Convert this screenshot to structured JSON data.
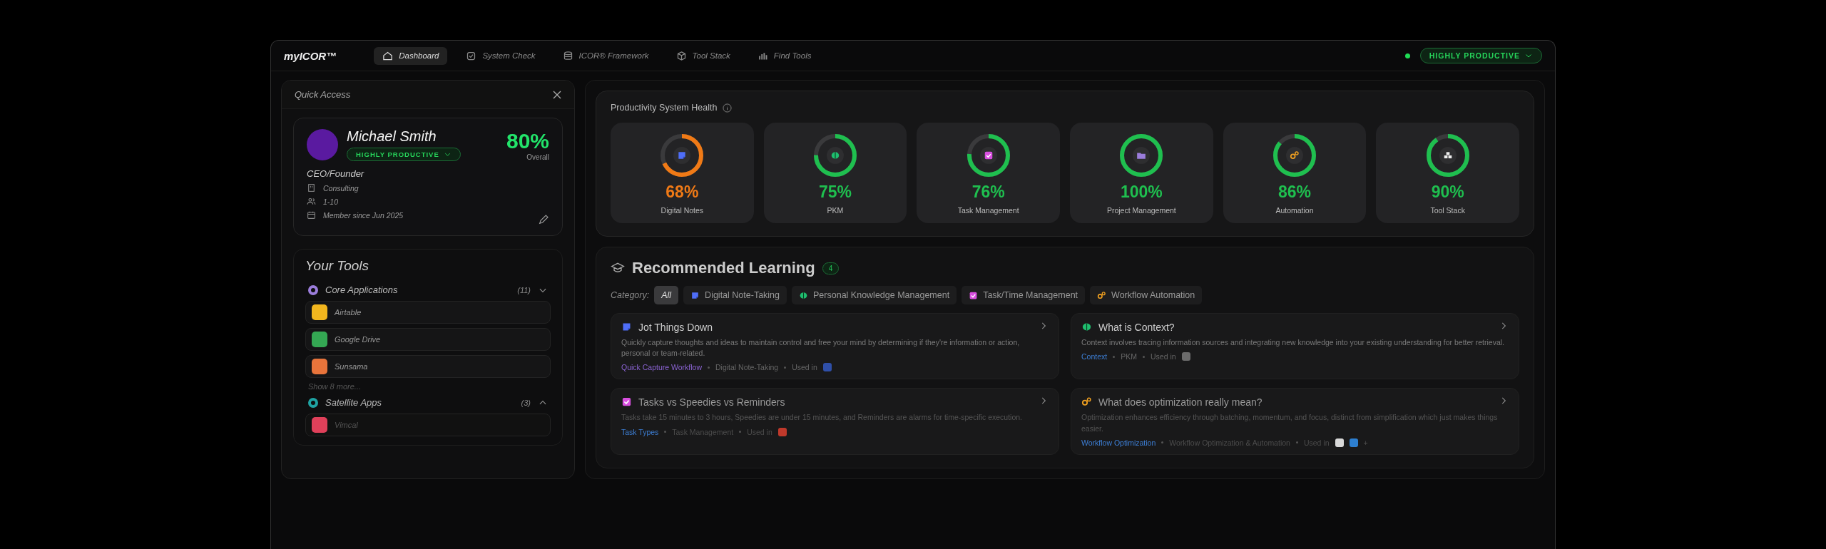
{
  "nav": {
    "logo": "myICOR™",
    "tabs": [
      {
        "label": "Dashboard",
        "selected": true
      },
      {
        "label": "System Check",
        "selected": false
      },
      {
        "label": "ICOR® Framework",
        "selected": false
      },
      {
        "label": "Tool Stack",
        "selected": false
      },
      {
        "label": "Find Tools",
        "selected": false
      }
    ],
    "status": {
      "online": true,
      "label": "HIGHLY PRODUCTIVE"
    }
  },
  "quick_access": {
    "title": "Quick Access",
    "profile": {
      "name": "Michael Smith",
      "badge": "HIGHLY PRODUCTIVE",
      "score": "80%",
      "score_label": "Overall",
      "role": "CEO/Founder",
      "details": [
        "Consulting",
        "1-10",
        "Member since Jun 2025"
      ]
    },
    "tools": {
      "title": "Your Tools",
      "groups": [
        {
          "name": "Core Applications",
          "count": "(11)",
          "expanded": true,
          "color": "#9b7ddb",
          "items": [
            {
              "name": "Airtable",
              "color": "#f2b61e"
            },
            {
              "name": "Google Drive",
              "color": "#34a853"
            },
            {
              "name": "Sunsama",
              "color": "#e8743b"
            }
          ],
          "more": "Show 8 more..."
        },
        {
          "name": "Satellite Apps",
          "count": "(3)",
          "expanded": false,
          "color": "#1fa3a3",
          "items": [
            {
              "name": "Vimcal",
              "color": "#e0405a"
            }
          ]
        }
      ]
    }
  },
  "health": {
    "title": "Productivity System Health",
    "cards": [
      {
        "label": "Digital Notes",
        "value": "68%",
        "level": 0.68,
        "color": "#f07a16"
      },
      {
        "label": "PKM",
        "value": "75%",
        "level": 0.75,
        "color": "#1fbf4f"
      },
      {
        "label": "Task Management",
        "value": "76%",
        "level": 0.76,
        "color": "#1fbf4f"
      },
      {
        "label": "Project Management",
        "value": "100%",
        "level": 1,
        "color": "#1fbf4f"
      },
      {
        "label": "Automation",
        "value": "86%",
        "level": 0.86,
        "color": "#1fbf4f"
      },
      {
        "label": "Tool Stack",
        "value": "90%",
        "level": 0.9,
        "color": "#1fbf4f"
      }
    ]
  },
  "learning": {
    "title": "Recommended Learning",
    "count": "4",
    "category_label": "Category:",
    "categories": [
      {
        "label": "All",
        "selected": true
      },
      {
        "label": "Digital Note-Taking",
        "selected": false
      },
      {
        "label": "Personal Knowledge Management",
        "selected": false
      },
      {
        "label": "Task/Time Management",
        "selected": false
      },
      {
        "label": "Workflow Automation",
        "selected": false
      }
    ],
    "cards": [
      {
        "title": "Jot Things Down",
        "description": "Quickly capture thoughts and ideas to maintain control and free your mind by determining if they're information or action, personal or team-related.",
        "link": "Quick Capture Workflow",
        "color": "#8a63d2",
        "category": "Digital Note-Taking",
        "used_in": "Used in",
        "apps": [
          {
            "color": "#2f4fa8"
          }
        ]
      },
      {
        "title": "What is Context?",
        "description": "Context involves tracing information sources and integrating new knowledge into your existing understanding for better retrieval.",
        "link": "Context",
        "color": "#3d7fd6",
        "category": "PKM",
        "used_in": "Used in",
        "apps": [
          {
            "color": "#6b6b6b"
          }
        ]
      },
      {
        "title": "Tasks vs Speedies vs Reminders",
        "description": "Tasks take 15 minutes to 3 hours, Speedies are under 15 minutes, and Reminders are alarms for time-specific execution.",
        "link": "Task Types",
        "color": "#3d7fd6",
        "category": "Task Management",
        "used_in": "Used in",
        "apps": [
          {
            "color": "#c0392b"
          }
        ]
      },
      {
        "title": "What does optimization really mean?",
        "description": "Optimization enhances efficiency through batching, momentum, and focus, distinct from simplification which just makes things easier.",
        "link": "Workflow Optimization",
        "color": "#3d7fd6",
        "category": "Workflow Optimization & Automation",
        "used_in": "Used in",
        "apps": [
          {
            "color": "#d8d8d8"
          },
          {
            "color": "#2d7fd0"
          }
        ],
        "extra": "+"
      }
    ]
  }
}
